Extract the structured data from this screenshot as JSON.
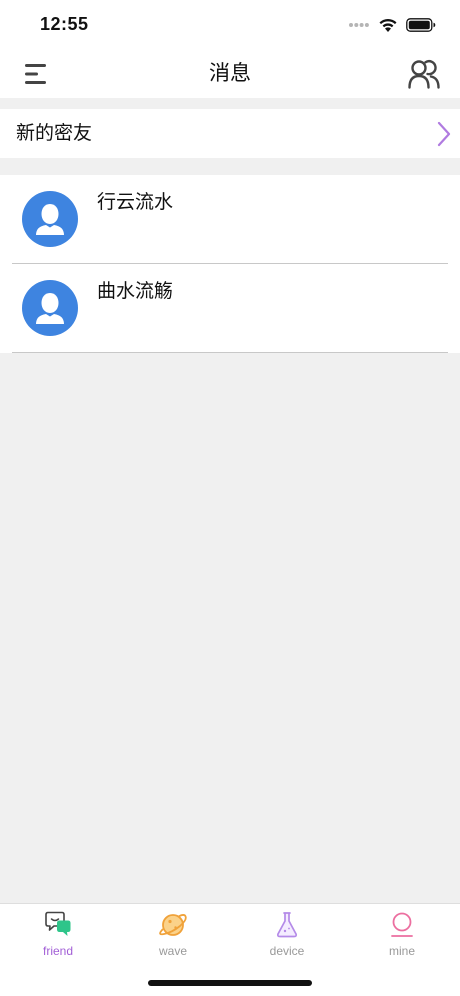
{
  "status_bar": {
    "time": "12:55"
  },
  "header": {
    "title": "消息",
    "menu_icon": "menu-icon",
    "friends_icon": "friends-icon"
  },
  "new_friends": {
    "label": "新的密友",
    "chevron_color": "#b07be0"
  },
  "contacts": [
    {
      "name": "行云流水",
      "avatar_icon": "person-avatar-icon"
    },
    {
      "name": "曲水流觞",
      "avatar_icon": "person-avatar-icon"
    }
  ],
  "colors": {
    "avatar_bg": "#3e84e0",
    "page_bg": "#f0f0f0"
  },
  "tabs": [
    {
      "label": "friend",
      "icon": "chat-bubbles-icon",
      "color": "#a25fd6",
      "active": true
    },
    {
      "label": "wave",
      "icon": "planet-icon",
      "color": "#999999",
      "active": false
    },
    {
      "label": "device",
      "icon": "flask-icon",
      "color": "#999999",
      "active": false
    },
    {
      "label": "mine",
      "icon": "profile-icon",
      "color": "#999999",
      "active": false
    }
  ]
}
